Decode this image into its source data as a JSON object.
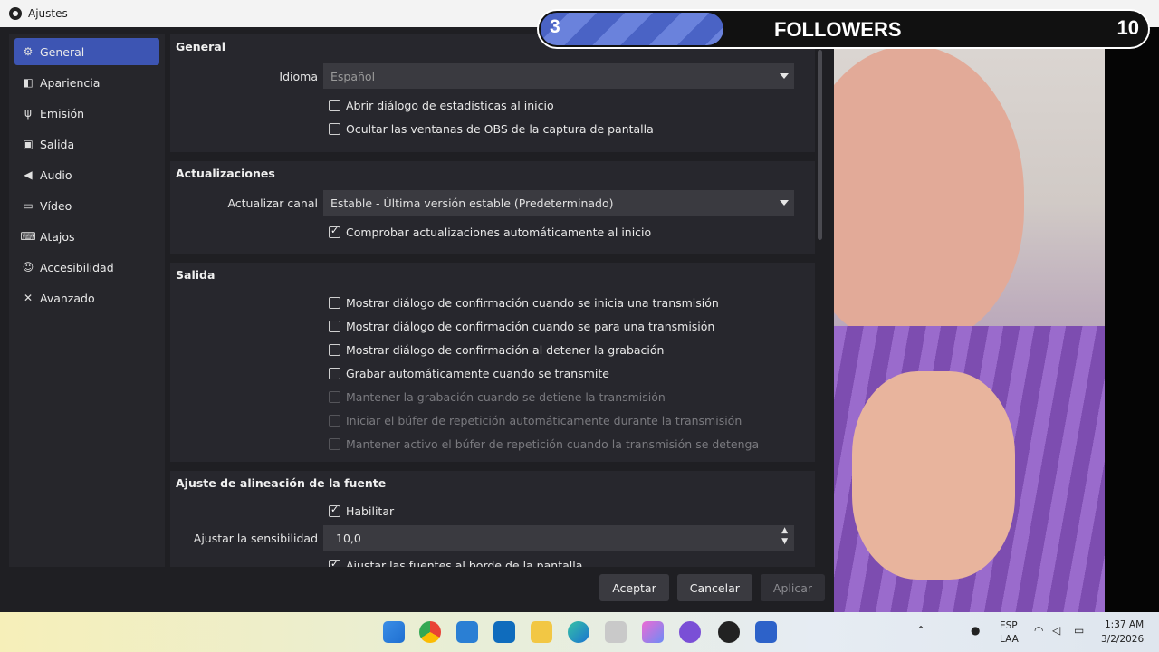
{
  "window": {
    "title": "Ajustes"
  },
  "sidebar": {
    "items": [
      {
        "label": "General",
        "icon": "gear-icon"
      },
      {
        "label": "Apariencia",
        "icon": "paint-icon"
      },
      {
        "label": "Emisión",
        "icon": "antenna-icon"
      },
      {
        "label": "Salida",
        "icon": "output-icon"
      },
      {
        "label": "Audio",
        "icon": "speaker-icon"
      },
      {
        "label": "Vídeo",
        "icon": "monitor-icon"
      },
      {
        "label": "Atajos",
        "icon": "keyboard-icon"
      },
      {
        "label": "Accesibilidad",
        "icon": "accessibility-icon"
      },
      {
        "label": "Avanzado",
        "icon": "tools-icon"
      }
    ],
    "active": "General"
  },
  "general": {
    "heading": "General",
    "language_label": "Idioma",
    "language_value": "Español",
    "stats_dialog": "Abrir diálogo de estadísticas al inicio",
    "hide_windows": "Ocultar las ventanas de OBS de la captura de pantalla"
  },
  "updates": {
    "heading": "Actualizaciones",
    "channel_label": "Actualizar canal",
    "channel_value": "Estable - Última versión estable (Predeterminado)",
    "check_updates": "Comprobar actualizaciones automáticamente al inicio"
  },
  "output": {
    "heading": "Salida",
    "options": [
      {
        "label": "Mostrar diálogo de confirmación cuando se inicia una transmisión",
        "checked": false,
        "enabled": true
      },
      {
        "label": "Mostrar diálogo de confirmación cuando se para una transmisión",
        "checked": false,
        "enabled": true
      },
      {
        "label": "Mostrar diálogo de confirmación al detener la grabación",
        "checked": false,
        "enabled": true
      },
      {
        "label": "Grabar automáticamente cuando se transmite",
        "checked": false,
        "enabled": true
      },
      {
        "label": "Mantener la grabación cuando se detiene la transmisión",
        "checked": false,
        "enabled": false
      },
      {
        "label": "Iniciar el búfer de repetición automáticamente durante la transmisión",
        "checked": false,
        "enabled": false
      },
      {
        "label": "Mantener activo el búfer de repetición cuando la transmisión se detenga",
        "checked": false,
        "enabled": false
      }
    ]
  },
  "snapping": {
    "heading": "Ajuste de alineación de la fuente",
    "enable_label": "Habilitar",
    "sensitivity_label": "Ajustar la sensibilidad",
    "sensitivity_value": "10,0",
    "snap_edges": "Ajustar las fuentes al borde de la pantalla"
  },
  "buttons": {
    "accept": "Aceptar",
    "cancel": "Cancelar",
    "apply": "Aplicar"
  },
  "overlay": {
    "left_count": "3",
    "label": "FOLLOWERS",
    "goal": "10",
    "progress_fraction": 0.3,
    "bar_color": "#4a63c5"
  },
  "tray": {
    "lang_top": "ESP",
    "lang_bottom": "LAA",
    "time": "1:37 AM",
    "date": "3/2/2026"
  }
}
